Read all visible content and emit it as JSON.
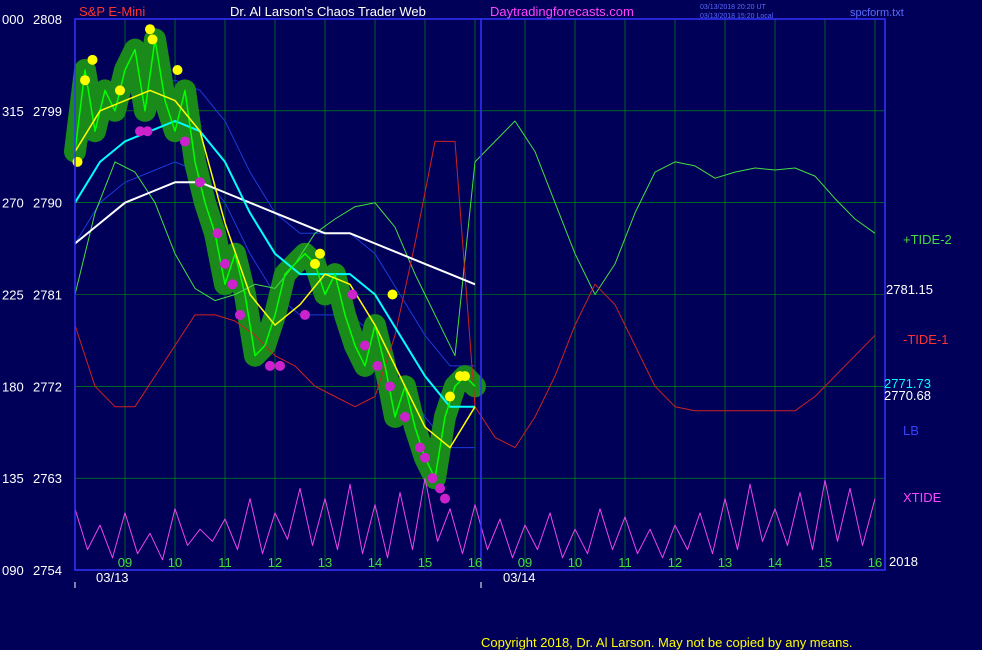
{
  "header": {
    "symbol": "S&P E-Mini",
    "title": "Dr. Al Larson's Chaos Trader Web",
    "site": "Daytradingforecasts.com",
    "timestamp_ut": "03/13/2018 20:20 UT",
    "timestamp_local": "03/13/2018 15:20 Local",
    "file": "spcform.txt"
  },
  "footer": {
    "copyright": "Copyright 2018, Dr. Al Larson. May not be copied by any means."
  },
  "colors": {
    "background": "#000058",
    "frame": "#3333ff",
    "grid": "#00a000",
    "price": "#00ff00",
    "fast_ma": "#ffff00",
    "mid_ma": "#00ffff",
    "slow_ma": "#ffffff",
    "band": "#1a3ad8",
    "tide2": "#44dd44",
    "tide1": "#cc2222",
    "xtide": "#ee44ee",
    "symbol": "#ff3333",
    "site": "#ff44ff",
    "peak_dot": "#ffff00",
    "trough_dot": "#cc22cc",
    "halo": "#1a8a1a"
  },
  "chart_data": {
    "type": "line",
    "title": "S&P E-Mini",
    "y_axis_left": {
      "ticks": [
        {
          "osc": "000",
          "price": "2808"
        },
        {
          "osc": "315",
          "price": "2799"
        },
        {
          "osc": "270",
          "price": "2790"
        },
        {
          "osc": "225",
          "price": "2781"
        },
        {
          "osc": "180",
          "price": "2772"
        },
        {
          "osc": "135",
          "price": "2763"
        },
        {
          "osc": "090",
          "price": "2754"
        }
      ],
      "price_range": [
        2754,
        2808
      ]
    },
    "x_axis": {
      "hour_ticks": [
        "09",
        "10",
        "11",
        "12",
        "13",
        "14",
        "15",
        "16",
        "09",
        "10",
        "11",
        "12",
        "13",
        "14",
        "15",
        "16"
      ],
      "date_labels": [
        "03/13",
        "03/14"
      ],
      "year_label": "2018"
    },
    "right_labels": {
      "tide2": "+TIDE-2",
      "last_price": "2781.15",
      "tide1": "-TIDE-1",
      "val_a": "2771.73",
      "val_b": "2770.68",
      "lb": "LB",
      "xtide": "XTIDE"
    },
    "series": [
      {
        "name": "Price",
        "x": [
          8.0,
          8.2,
          8.4,
          8.6,
          8.8,
          9.0,
          9.2,
          9.4,
          9.6,
          9.8,
          10.0,
          10.2,
          10.4,
          10.6,
          10.8,
          11.0,
          11.2,
          11.4,
          11.6,
          11.8,
          12.0,
          12.2,
          12.4,
          12.6,
          12.8,
          13.0,
          13.2,
          13.4,
          13.6,
          13.8,
          14.0,
          14.2,
          14.4,
          14.6,
          14.8,
          15.0,
          15.2,
          15.4,
          15.6,
          15.8,
          16.0
        ],
        "values": [
          2795,
          2803,
          2797,
          2801,
          2799,
          2803,
          2805,
          2799,
          2806,
          2800,
          2797,
          2801,
          2794,
          2790,
          2787,
          2782,
          2785,
          2781,
          2775,
          2776,
          2779,
          2783,
          2784,
          2785,
          2784,
          2781,
          2783,
          2779,
          2776,
          2774,
          2778,
          2774,
          2769,
          2772,
          2768,
          2765,
          2763,
          2769,
          2772,
          2773,
          2772
        ]
      },
      {
        "name": "Yellow MA",
        "x": [
          8.0,
          8.5,
          9.0,
          9.5,
          10.0,
          10.5,
          11.0,
          11.5,
          12.0,
          12.5,
          13.0,
          13.5,
          14.0,
          14.5,
          15.0,
          15.5,
          16.0
        ],
        "values": [
          2795,
          2799,
          2800,
          2801,
          2800,
          2797,
          2788,
          2781,
          2778,
          2780,
          2783,
          2782,
          2778,
          2773,
          2768,
          2766,
          2770
        ]
      },
      {
        "name": "Cyan MA",
        "x": [
          8.0,
          8.5,
          9.0,
          9.5,
          10.0,
          10.5,
          11.0,
          11.5,
          12.0,
          12.5,
          13.0,
          13.5,
          14.0,
          14.5,
          15.0,
          15.5,
          16.0
        ],
        "values": [
          2790,
          2794,
          2796,
          2797,
          2798,
          2797,
          2794,
          2789,
          2785,
          2783,
          2783,
          2783,
          2781,
          2777,
          2773,
          2770,
          2770
        ]
      },
      {
        "name": "White MA",
        "x": [
          8.0,
          8.5,
          9.0,
          9.5,
          10.0,
          10.5,
          11.0,
          11.5,
          12.0,
          12.5,
          13.0,
          13.5,
          14.0,
          14.5,
          15.0,
          15.5,
          16.0
        ],
        "values": [
          2786,
          2788,
          2790,
          2791,
          2792,
          2792,
          2791,
          2790,
          2789,
          2788,
          2787,
          2787,
          2786,
          2785,
          2784,
          2783,
          2782
        ]
      },
      {
        "name": "+TIDE-2",
        "x": [
          8.0,
          8.4,
          8.8,
          9.2,
          9.6,
          10.0,
          10.4,
          10.8,
          11.2,
          11.6,
          12.0,
          12.4,
          12.8,
          13.2,
          13.6,
          14.0,
          14.4,
          14.8,
          15.2,
          15.6,
          16.0,
          16.4,
          16.8,
          17.2,
          17.6,
          18.0,
          18.4,
          18.8,
          19.2,
          19.6,
          20.0,
          20.4,
          20.8,
          21.2,
          21.6,
          22.0,
          22.4,
          22.8,
          23.2,
          23.6,
          24.0
        ],
        "values": [
          225,
          265,
          290,
          285,
          270,
          245,
          228,
          222,
          225,
          230,
          228,
          240,
          255,
          262,
          268,
          270,
          258,
          235,
          215,
          195,
          290,
          300,
          310,
          295,
          270,
          245,
          225,
          240,
          265,
          285,
          290,
          288,
          282,
          285,
          287,
          286,
          287,
          283,
          272,
          262,
          255
        ]
      },
      {
        "name": "-TIDE-1",
        "x": [
          8.0,
          8.4,
          8.8,
          9.2,
          9.6,
          10.0,
          10.4,
          10.8,
          11.2,
          11.6,
          12.0,
          12.4,
          12.8,
          13.2,
          13.6,
          14.0,
          14.4,
          14.8,
          15.2,
          15.6,
          16.0,
          16.4,
          16.8,
          17.2,
          17.6,
          18.0,
          18.4,
          18.8,
          19.2,
          19.6,
          20.0,
          20.4,
          20.8,
          21.2,
          21.6,
          22.0,
          22.4,
          22.8,
          23.2,
          23.6,
          24.0
        ],
        "values": [
          210,
          180,
          170,
          170,
          185,
          200,
          215,
          215,
          212,
          205,
          195,
          190,
          180,
          175,
          170,
          175,
          205,
          250,
          300,
          300,
          170,
          155,
          150,
          165,
          185,
          210,
          230,
          220,
          200,
          180,
          170,
          168,
          168,
          168,
          168,
          168,
          168,
          175,
          185,
          195,
          205
        ]
      },
      {
        "name": "XTIDE",
        "x": [
          8.0,
          8.25,
          8.5,
          8.75,
          9.0,
          9.25,
          9.5,
          9.75,
          10.0,
          10.25,
          10.5,
          10.75,
          11.0,
          11.25,
          11.5,
          11.75,
          12.0,
          12.25,
          12.5,
          12.75,
          13.0,
          13.25,
          13.5,
          13.75,
          14.0,
          14.25,
          14.5,
          14.75,
          15.0,
          15.25,
          15.5,
          15.75,
          16.0,
          16.25,
          16.5,
          16.75,
          17.0,
          17.25,
          17.5,
          17.75,
          18.0,
          18.25,
          18.5,
          18.75,
          19.0,
          19.25,
          19.5,
          19.75,
          20.0,
          20.25,
          20.5,
          20.75,
          21.0,
          21.25,
          21.5,
          21.75,
          22.0,
          22.25,
          22.5,
          22.75,
          23.0,
          23.25,
          23.5,
          23.75,
          24.0
        ],
        "values": [
          120,
          100,
          112,
          96,
          118,
          98,
          108,
          95,
          120,
          102,
          110,
          104,
          115,
          100,
          125,
          98,
          118,
          105,
          130,
          102,
          125,
          100,
          132,
          98,
          122,
          96,
          128,
          100,
          135,
          104,
          120,
          98,
          122,
          100,
          115,
          96,
          112,
          100,
          118,
          96,
          110,
          98,
          120,
          100,
          116,
          98,
          110,
          96,
          112,
          100,
          118,
          98,
          125,
          100,
          132,
          104,
          120,
          102,
          128,
          100,
          134,
          104,
          130,
          102,
          125
        ]
      }
    ],
    "peak_dots": [
      [
        8.05,
        2794
      ],
      [
        8.2,
        2802
      ],
      [
        8.35,
        2804
      ],
      [
        8.9,
        2801
      ],
      [
        9.5,
        2807
      ],
      [
        9.55,
        2806
      ],
      [
        10.05,
        2803
      ],
      [
        12.8,
        2784
      ],
      [
        12.9,
        2785
      ],
      [
        14.35,
        2781
      ],
      [
        15.5,
        2771
      ],
      [
        15.7,
        2773
      ],
      [
        15.8,
        2773
      ]
    ],
    "trough_dots": [
      [
        9.3,
        2797
      ],
      [
        9.45,
        2797
      ],
      [
        10.2,
        2796
      ],
      [
        10.5,
        2792
      ],
      [
        10.85,
        2787
      ],
      [
        11.0,
        2784
      ],
      [
        11.15,
        2782
      ],
      [
        11.3,
        2779
      ],
      [
        11.9,
        2774
      ],
      [
        12.1,
        2774
      ],
      [
        12.6,
        2779
      ],
      [
        13.55,
        2781
      ],
      [
        13.8,
        2776
      ],
      [
        14.05,
        2774
      ],
      [
        14.3,
        2772
      ],
      [
        14.6,
        2769
      ],
      [
        14.9,
        2766
      ],
      [
        15.0,
        2765
      ],
      [
        15.15,
        2763
      ],
      [
        15.3,
        2762
      ],
      [
        15.4,
        2761
      ]
    ]
  }
}
